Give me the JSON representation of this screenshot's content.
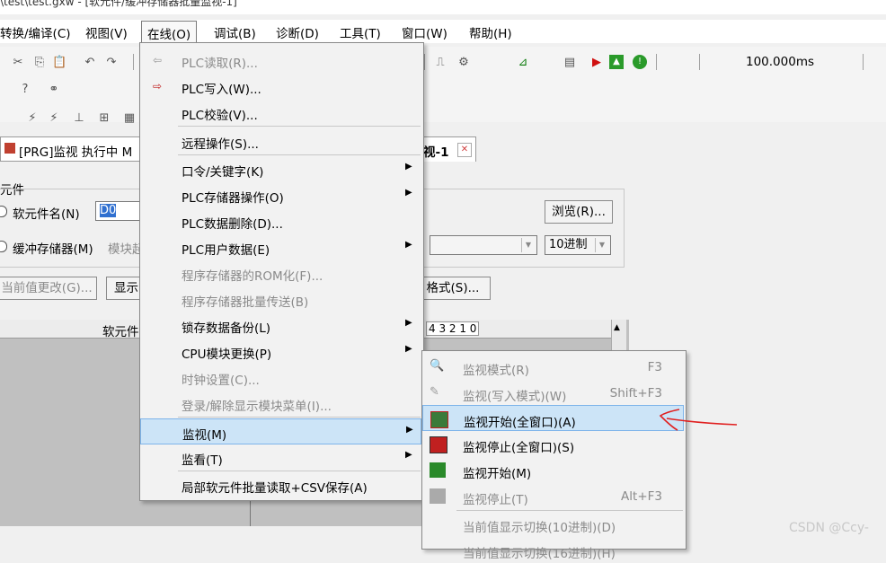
{
  "window": {
    "title": "\\test\\test.gxw - [软元件/缓冲存储器批量监视-1]"
  },
  "menubar": [
    {
      "label": "转换/编译(C)"
    },
    {
      "label": "视图(V)"
    },
    {
      "label": "在线(O)"
    },
    {
      "label": "调试(B)"
    },
    {
      "label": "诊断(D)"
    },
    {
      "label": "工具(T)"
    },
    {
      "label": "窗口(W)"
    },
    {
      "label": "帮助(H)"
    }
  ],
  "toolbar": {
    "interval": "100.000ms"
  },
  "tabs": {
    "left_tab": "[PRG]监视 执行中 M",
    "right_tab": "视-1",
    "right_tab_close": "✕"
  },
  "panel": {
    "group_title": "元件",
    "radio_device": "软元件名(N)",
    "device_value": "D0",
    "radio_buffer": "缓冲存储器(M)",
    "module_label": "模块起",
    "browse_button": "浏览(R)...",
    "radix_select": "10进制",
    "current_value_button": "当前值更改(G)...",
    "display_button": "显示",
    "format_button": "格式(S)...",
    "device_column_header": "软元件",
    "bit_header": "4 3 2 1 0"
  },
  "online_menu": {
    "items": [
      {
        "label": "PLC读取(R)...",
        "enabled": false,
        "icon": "plc-read-icon"
      },
      {
        "label": "PLC写入(W)...",
        "enabled": true,
        "icon": "plc-write-icon"
      },
      {
        "label": "PLC校验(V)...",
        "enabled": true
      },
      {
        "label": "远程操作(S)...",
        "enabled": true
      },
      {
        "label": "口令/关键字(K)",
        "enabled": true,
        "submenu": true
      },
      {
        "label": "PLC存储器操作(O)",
        "enabled": true,
        "submenu": true
      },
      {
        "label": "PLC数据删除(D)...",
        "enabled": true
      },
      {
        "label": "PLC用户数据(E)",
        "enabled": true,
        "submenu": true
      },
      {
        "label": "程序存储器的ROM化(F)...",
        "enabled": false
      },
      {
        "label": "程序存储器批量传送(B)",
        "enabled": false
      },
      {
        "label": "锁存数据备份(L)",
        "enabled": true,
        "submenu": true
      },
      {
        "label": "CPU模块更换(P)",
        "enabled": true,
        "submenu": true
      },
      {
        "label": "时钟设置(C)...",
        "enabled": false
      },
      {
        "label": "登录/解除显示模块菜单(I)...",
        "enabled": false
      },
      {
        "label": "监视(M)",
        "enabled": true,
        "submenu": true,
        "highlighted": true
      },
      {
        "label": "监看(T)",
        "enabled": true,
        "submenu": true
      },
      {
        "label": "局部软元件批量读取+CSV保存(A)",
        "enabled": true
      }
    ]
  },
  "monitor_submenu": {
    "items": [
      {
        "label": "监视模式(R)",
        "shortcut": "F3",
        "enabled": false
      },
      {
        "label": "监视(写入模式)(W)",
        "shortcut": "Shift+F3",
        "enabled": false
      },
      {
        "label": "监视开始(全窗口)(A)",
        "shortcut": "",
        "enabled": true,
        "highlighted": true
      },
      {
        "label": "监视停止(全窗口)(S)",
        "shortcut": "",
        "enabled": true
      },
      {
        "label": "监视开始(M)",
        "shortcut": "",
        "enabled": true
      },
      {
        "label": "监视停止(T)",
        "shortcut": "Alt+F3",
        "enabled": false
      },
      {
        "label": "当前值显示切换(10进制)(D)",
        "shortcut": "",
        "enabled": false
      },
      {
        "label": "当前值显示切换(16进制)(H)",
        "shortcut": "",
        "enabled": false
      }
    ]
  },
  "watermark": "CSDN @Ccy-",
  "colors": {
    "highlight_bg": "#cce4f7",
    "highlight_border": "#7eb4ea",
    "annotation": "#e02020"
  }
}
